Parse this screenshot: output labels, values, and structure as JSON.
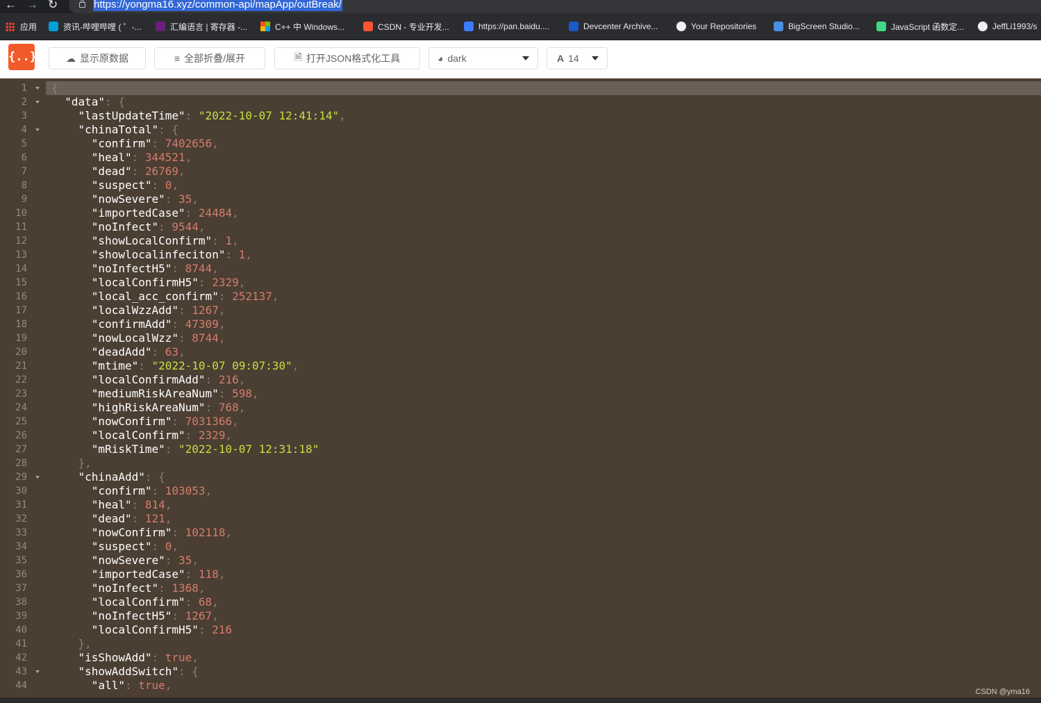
{
  "browser": {
    "url": "https://yongma16.xyz/common-api/mapApp/outBreak/",
    "bookmarks": [
      {
        "label": "应用",
        "icon": "apps-grid-icon"
      },
      {
        "label": "资讯-哔哩哔哩 ( ゜-...",
        "icon": "bilibili-icon"
      },
      {
        "label": "汇编语言 | 寄存器 -...",
        "icon": "visual-studio-icon"
      },
      {
        "label": "C++ 中 Windows...",
        "icon": "microsoft-icon"
      },
      {
        "label": "CSDN - 专业开发...",
        "icon": "csdn-icon"
      },
      {
        "label": "https://pan.baidu....",
        "icon": "baidu-pan-icon"
      },
      {
        "label": "Devcenter Archive...",
        "icon": "w-icon"
      },
      {
        "label": "Your Repositories",
        "icon": "github-icon"
      },
      {
        "label": "BigScreen Studio...",
        "icon": "bigscreen-icon"
      },
      {
        "label": "JavaScript 函数定...",
        "icon": "android-icon"
      },
      {
        "label": "JeffLi1993/s",
        "icon": "github-icon"
      }
    ]
  },
  "toolbar": {
    "logo": "{..}",
    "raw_label": "显示原数据",
    "fold_label": "全部折叠/展开",
    "tool_label": "打开JSON格式化工具",
    "theme_value": "dark",
    "font_size_value": "14"
  },
  "editor": {
    "lines": [
      [
        [
          "p",
          "{"
        ]
      ],
      [
        [
          "k",
          "  \"data\""
        ],
        [
          "p",
          ": {"
        ]
      ],
      [
        [
          "k",
          "    \"lastUpdateTime\""
        ],
        [
          "p",
          ": "
        ],
        [
          "s",
          "\"2022-10-07 12:41:14\""
        ],
        [
          "p",
          ","
        ]
      ],
      [
        [
          "k",
          "    \"chinaTotal\""
        ],
        [
          "p",
          ": {"
        ]
      ],
      [
        [
          "k",
          "      \"confirm\""
        ],
        [
          "p",
          ": "
        ],
        [
          "n",
          "7402656"
        ],
        [
          "p",
          ","
        ]
      ],
      [
        [
          "k",
          "      \"heal\""
        ],
        [
          "p",
          ": "
        ],
        [
          "n",
          "344521"
        ],
        [
          "p",
          ","
        ]
      ],
      [
        [
          "k",
          "      \"dead\""
        ],
        [
          "p",
          ": "
        ],
        [
          "n",
          "26769"
        ],
        [
          "p",
          ","
        ]
      ],
      [
        [
          "k",
          "      \"suspect\""
        ],
        [
          "p",
          ": "
        ],
        [
          "n",
          "0"
        ],
        [
          "p",
          ","
        ]
      ],
      [
        [
          "k",
          "      \"nowSevere\""
        ],
        [
          "p",
          ": "
        ],
        [
          "n",
          "35"
        ],
        [
          "p",
          ","
        ]
      ],
      [
        [
          "k",
          "      \"importedCase\""
        ],
        [
          "p",
          ": "
        ],
        [
          "n",
          "24484"
        ],
        [
          "p",
          ","
        ]
      ],
      [
        [
          "k",
          "      \"noInfect\""
        ],
        [
          "p",
          ": "
        ],
        [
          "n",
          "9544"
        ],
        [
          "p",
          ","
        ]
      ],
      [
        [
          "k",
          "      \"showLocalConfirm\""
        ],
        [
          "p",
          ": "
        ],
        [
          "n",
          "1"
        ],
        [
          "p",
          ","
        ]
      ],
      [
        [
          "k",
          "      \"showlocalinfeciton\""
        ],
        [
          "p",
          ": "
        ],
        [
          "n",
          "1"
        ],
        [
          "p",
          ","
        ]
      ],
      [
        [
          "k",
          "      \"noInfectH5\""
        ],
        [
          "p",
          ": "
        ],
        [
          "n",
          "8744"
        ],
        [
          "p",
          ","
        ]
      ],
      [
        [
          "k",
          "      \"localConfirmH5\""
        ],
        [
          "p",
          ": "
        ],
        [
          "n",
          "2329"
        ],
        [
          "p",
          ","
        ]
      ],
      [
        [
          "k",
          "      \"local_acc_confirm\""
        ],
        [
          "p",
          ": "
        ],
        [
          "n",
          "252137"
        ],
        [
          "p",
          ","
        ]
      ],
      [
        [
          "k",
          "      \"localWzzAdd\""
        ],
        [
          "p",
          ": "
        ],
        [
          "n",
          "1267"
        ],
        [
          "p",
          ","
        ]
      ],
      [
        [
          "k",
          "      \"confirmAdd\""
        ],
        [
          "p",
          ": "
        ],
        [
          "n",
          "47309"
        ],
        [
          "p",
          ","
        ]
      ],
      [
        [
          "k",
          "      \"nowLocalWzz\""
        ],
        [
          "p",
          ": "
        ],
        [
          "n",
          "8744"
        ],
        [
          "p",
          ","
        ]
      ],
      [
        [
          "k",
          "      \"deadAdd\""
        ],
        [
          "p",
          ": "
        ],
        [
          "n",
          "63"
        ],
        [
          "p",
          ","
        ]
      ],
      [
        [
          "k",
          "      \"mtime\""
        ],
        [
          "p",
          ": "
        ],
        [
          "s",
          "\"2022-10-07 09:07:30\""
        ],
        [
          "p",
          ","
        ]
      ],
      [
        [
          "k",
          "      \"localConfirmAdd\""
        ],
        [
          "p",
          ": "
        ],
        [
          "n",
          "216"
        ],
        [
          "p",
          ","
        ]
      ],
      [
        [
          "k",
          "      \"mediumRiskAreaNum\""
        ],
        [
          "p",
          ": "
        ],
        [
          "n",
          "598"
        ],
        [
          "p",
          ","
        ]
      ],
      [
        [
          "k",
          "      \"highRiskAreaNum\""
        ],
        [
          "p",
          ": "
        ],
        [
          "n",
          "768"
        ],
        [
          "p",
          ","
        ]
      ],
      [
        [
          "k",
          "      \"nowConfirm\""
        ],
        [
          "p",
          ": "
        ],
        [
          "n",
          "7031366"
        ],
        [
          "p",
          ","
        ]
      ],
      [
        [
          "k",
          "      \"localConfirm\""
        ],
        [
          "p",
          ": "
        ],
        [
          "n",
          "2329"
        ],
        [
          "p",
          ","
        ]
      ],
      [
        [
          "k",
          "      \"mRiskTime\""
        ],
        [
          "p",
          ": "
        ],
        [
          "s",
          "\"2022-10-07 12:31:18\""
        ]
      ],
      [
        [
          "p",
          "    },"
        ]
      ],
      [
        [
          "k",
          "    \"chinaAdd\""
        ],
        [
          "p",
          ": {"
        ]
      ],
      [
        [
          "k",
          "      \"confirm\""
        ],
        [
          "p",
          ": "
        ],
        [
          "n",
          "103053"
        ],
        [
          "p",
          ","
        ]
      ],
      [
        [
          "k",
          "      \"heal\""
        ],
        [
          "p",
          ": "
        ],
        [
          "n",
          "814"
        ],
        [
          "p",
          ","
        ]
      ],
      [
        [
          "k",
          "      \"dead\""
        ],
        [
          "p",
          ": "
        ],
        [
          "n",
          "121"
        ],
        [
          "p",
          ","
        ]
      ],
      [
        [
          "k",
          "      \"nowConfirm\""
        ],
        [
          "p",
          ": "
        ],
        [
          "n",
          "102118"
        ],
        [
          "p",
          ","
        ]
      ],
      [
        [
          "k",
          "      \"suspect\""
        ],
        [
          "p",
          ": "
        ],
        [
          "n",
          "0"
        ],
        [
          "p",
          ","
        ]
      ],
      [
        [
          "k",
          "      \"nowSevere\""
        ],
        [
          "p",
          ": "
        ],
        [
          "n",
          "35"
        ],
        [
          "p",
          ","
        ]
      ],
      [
        [
          "k",
          "      \"importedCase\""
        ],
        [
          "p",
          ": "
        ],
        [
          "n",
          "118"
        ],
        [
          "p",
          ","
        ]
      ],
      [
        [
          "k",
          "      \"noInfect\""
        ],
        [
          "p",
          ": "
        ],
        [
          "n",
          "1368"
        ],
        [
          "p",
          ","
        ]
      ],
      [
        [
          "k",
          "      \"localConfirm\""
        ],
        [
          "p",
          ": "
        ],
        [
          "n",
          "68"
        ],
        [
          "p",
          ","
        ]
      ],
      [
        [
          "k",
          "      \"noInfectH5\""
        ],
        [
          "p",
          ": "
        ],
        [
          "n",
          "1267"
        ],
        [
          "p",
          ","
        ]
      ],
      [
        [
          "k",
          "      \"localConfirmH5\""
        ],
        [
          "p",
          ": "
        ],
        [
          "n",
          "216"
        ]
      ],
      [
        [
          "p",
          "    },"
        ]
      ],
      [
        [
          "k",
          "    \"isShowAdd\""
        ],
        [
          "p",
          ": "
        ],
        [
          "b",
          "true"
        ],
        [
          "p",
          ","
        ]
      ],
      [
        [
          "k",
          "    \"showAddSwitch\""
        ],
        [
          "p",
          ": {"
        ]
      ],
      [
        [
          "k",
          "      \"all\""
        ],
        [
          "p",
          ": "
        ],
        [
          "b",
          "true"
        ],
        [
          "p",
          ","
        ]
      ]
    ],
    "fold_lines": [
      1,
      2,
      4,
      29,
      43
    ]
  },
  "watermark": "CSDN @yma16"
}
